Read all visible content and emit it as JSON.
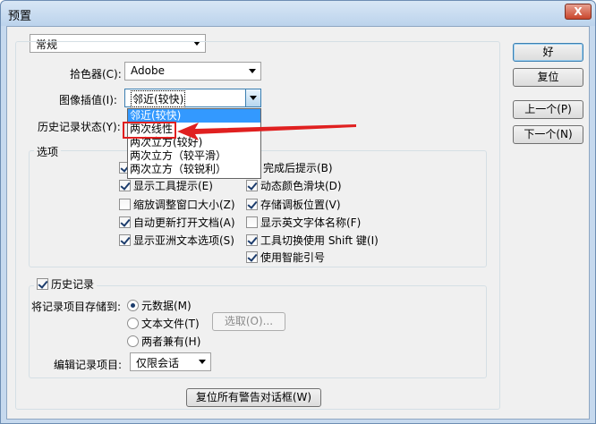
{
  "window": {
    "title": "预置",
    "close_label": "X"
  },
  "general": {
    "category_combo": "常规"
  },
  "color_picker": {
    "label": "拾色器(C):",
    "value": "Adobe"
  },
  "image_interp": {
    "label": "图像插值(I):",
    "value": "邻近(较快)",
    "options": [
      {
        "label": "邻近(较快)"
      },
      {
        "label": "两次线性"
      },
      {
        "label": "两次立方(较好)"
      },
      {
        "label": "两次立方（较平滑）"
      },
      {
        "label": "两次立方（较锐利）"
      }
    ]
  },
  "history_state": {
    "label": "历史记录状态(Y):"
  },
  "options_group": {
    "title": "选项",
    "left": [
      {
        "label": "",
        "checked": true
      },
      {
        "label": "显示工具提示(E)",
        "checked": true
      },
      {
        "label": "缩放调整窗口大小(Z)",
        "checked": false
      },
      {
        "label": "自动更新打开文档(A)",
        "checked": true
      },
      {
        "label": "显示亚洲文本选项(S)",
        "checked": true
      }
    ],
    "right": [
      {
        "label": "完成后提示(B)",
        "checked": false
      },
      {
        "label": "动态颜色滑块(D)",
        "checked": true
      },
      {
        "label": "存储调板位置(V)",
        "checked": true
      },
      {
        "label": "显示英文字体名称(F)",
        "checked": false
      },
      {
        "label": "工具切换使用 Shift 键(I)",
        "checked": true
      },
      {
        "label": "使用智能引号",
        "checked": true
      }
    ]
  },
  "history_group": {
    "title": "历史记录",
    "checked": true,
    "save_to_label": "将记录项目存储到:",
    "radios": [
      {
        "label": "元数据(M)",
        "selected": true
      },
      {
        "label": "文本文件(T)",
        "selected": false
      },
      {
        "label": "两者兼有(H)",
        "selected": false
      }
    ],
    "choose_button": "选取(O)...",
    "edit_label": "编辑记录项目:",
    "edit_value": "仅限会话"
  },
  "reset_warnings_button": "复位所有警告对话框(W)",
  "side_buttons": {
    "ok": "好",
    "reset": "复位",
    "prev": "上一个(P)",
    "next": "下一个(N)"
  },
  "colors": {
    "highlight": "#3399ff",
    "annotation_red": "#e02020"
  }
}
